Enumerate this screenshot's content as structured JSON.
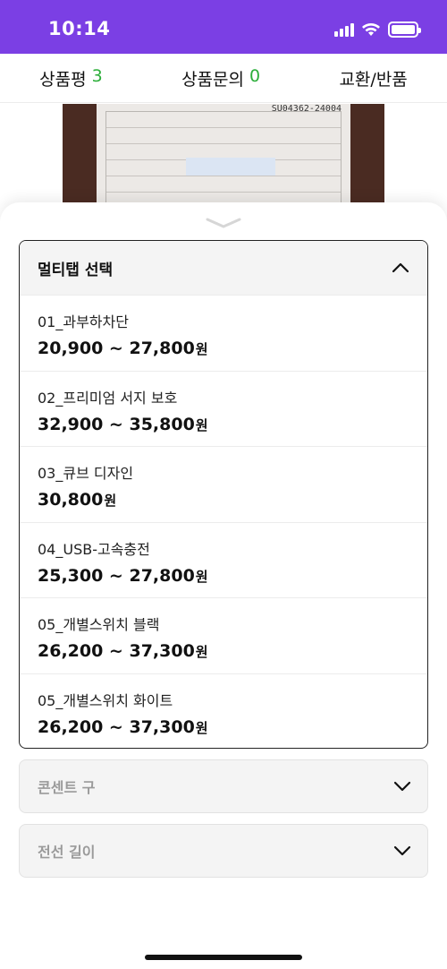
{
  "status_bar": {
    "time": "10:14",
    "icons": [
      "signal-icon",
      "wifi-icon",
      "battery-icon"
    ],
    "background_color": "#7b3fe4"
  },
  "tabs": [
    {
      "label": "상품평",
      "count": "3"
    },
    {
      "label": "상품문의",
      "count": "0"
    },
    {
      "label": "교환/반품",
      "count": ""
    }
  ],
  "product_image": {
    "visible_code": "SU04362-24004"
  },
  "option_dropdown": {
    "title": "멀티탭 선택",
    "expanded": true,
    "options": [
      {
        "name": "01_과부하차단",
        "price": "20,900 ~ 27,800",
        "unit": "원"
      },
      {
        "name": "02_프리미엄 서지 보호",
        "price": "32,900 ~ 35,800",
        "unit": "원"
      },
      {
        "name": "03_큐브 디자인",
        "price": "30,800",
        "unit": "원"
      },
      {
        "name": "04_USB-고속충전",
        "price": "25,300 ~ 27,800",
        "unit": "원"
      },
      {
        "name": "05_개별스위치 블랙",
        "price": "26,200 ~ 37,300",
        "unit": "원"
      },
      {
        "name": "05_개별스위치 화이트",
        "price": "26,200 ~ 37,300",
        "unit": "원"
      }
    ]
  },
  "secondary_selects": [
    {
      "label": "콘센트 구"
    },
    {
      "label": "전선 길이"
    }
  ],
  "colors": {
    "accent": "#7b3fe4",
    "count_green": "#2cae3a"
  }
}
